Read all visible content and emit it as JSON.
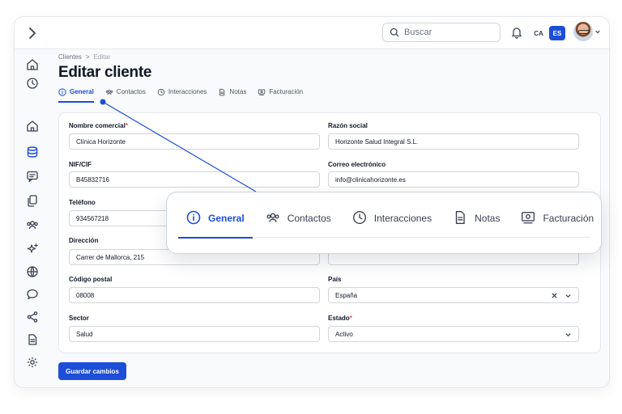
{
  "topbar": {
    "search_placeholder": "Buscar",
    "lang_ca": "CA",
    "lang_es": "ES"
  },
  "sidebar": {
    "items": [
      {
        "icon": "home-icon"
      },
      {
        "icon": "clock-icon"
      },
      {
        "icon": "home-icon"
      },
      {
        "icon": "database-icon",
        "active": true
      },
      {
        "icon": "chat-icon"
      },
      {
        "icon": "copy-icon"
      },
      {
        "icon": "users-icon"
      },
      {
        "icon": "sparkles-icon"
      },
      {
        "icon": "globe-icon"
      },
      {
        "icon": "comment-icon"
      },
      {
        "icon": "share-icon"
      },
      {
        "icon": "document-icon"
      },
      {
        "icon": "gear-icon"
      }
    ]
  },
  "breadcrumb": {
    "parent": "Clientes",
    "separator": ">",
    "current": "Editar"
  },
  "page_title": "Editar cliente",
  "tabs": [
    {
      "label": "General",
      "icon": "info-icon",
      "active": true
    },
    {
      "label": "Contactos",
      "icon": "users-icon"
    },
    {
      "label": "Interacciones",
      "icon": "clock-icon"
    },
    {
      "label": "Notas",
      "icon": "document-icon"
    },
    {
      "label": "Facturación",
      "icon": "invoice-icon"
    }
  ],
  "form": {
    "nombre_comercial": {
      "label": "Nombre comercial",
      "required": "*",
      "value": "Clínica Horizonte"
    },
    "razon_social": {
      "label": "Razón social",
      "value": "Horizonte Salud Integral S.L."
    },
    "nif": {
      "label": "NIF/CIF",
      "value": "B45832716"
    },
    "correo": {
      "label": "Correo electrónico",
      "value": "info@clinicahorizonte.es"
    },
    "telefono": {
      "label": "Teléfono",
      "value": "934567218"
    },
    "direccion": {
      "label": "Dirección",
      "value": "Carrer de Mallorca, 215"
    },
    "codigo_postal": {
      "label": "Código postal",
      "value": "08008"
    },
    "pais": {
      "label": "País",
      "value": "España"
    },
    "sector": {
      "label": "Sector",
      "value": "Salud"
    },
    "estado": {
      "label": "Estado",
      "required": "*",
      "value": "Activo"
    }
  },
  "save_button": "Guardar cambios",
  "colors": {
    "accent": "#1d4ed8",
    "required": "#ef4444",
    "border": "#e5e7eb"
  }
}
